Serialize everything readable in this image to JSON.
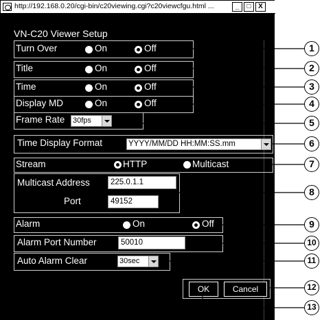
{
  "window": {
    "url": "http://192.168.0.20/cgi-bin/c20viewing.cgi?c20viewcfgu.html ...",
    "minimize_glyph": "_",
    "maximize_glyph": "□",
    "close_glyph": "X"
  },
  "heading": "VN-C20 Viewer Setup",
  "settings": {
    "turn_over": {
      "label": "Turn Over",
      "on": "On",
      "off": "Off",
      "selected": "off"
    },
    "title": {
      "label": "Title",
      "on": "On",
      "off": "Off",
      "selected": "off"
    },
    "time": {
      "label": "Time",
      "on": "On",
      "off": "Off",
      "selected": "off"
    },
    "display_md": {
      "label": "Display MD",
      "on": "On",
      "off": "Off",
      "selected": "off"
    },
    "frame_rate": {
      "label": "Frame Rate",
      "value": "30fps"
    },
    "time_display_format": {
      "label": "Time Display Format",
      "value": "YYYY/MM/DD HH:MM:SS.mm"
    },
    "stream": {
      "label": "Stream",
      "http": "HTTP",
      "multicast": "Multicast",
      "selected": "http"
    },
    "multicast_address": {
      "label": "Multicast Address",
      "value": "225.0.1.1"
    },
    "port": {
      "label": "Port",
      "value": "49152"
    },
    "alarm": {
      "label": "Alarm",
      "on": "On",
      "off": "Off",
      "selected": "off"
    },
    "alarm_port_number": {
      "label": "Alarm Port Number",
      "value": "50010"
    },
    "auto_alarm_clear": {
      "label": "Auto Alarm Clear",
      "value": "30sec"
    }
  },
  "buttons": {
    "ok": "OK",
    "cancel": "Cancel"
  },
  "callouts": [
    "1",
    "2",
    "3",
    "4",
    "5",
    "6",
    "7",
    "8",
    "9",
    "10",
    "11",
    "12",
    "13"
  ]
}
